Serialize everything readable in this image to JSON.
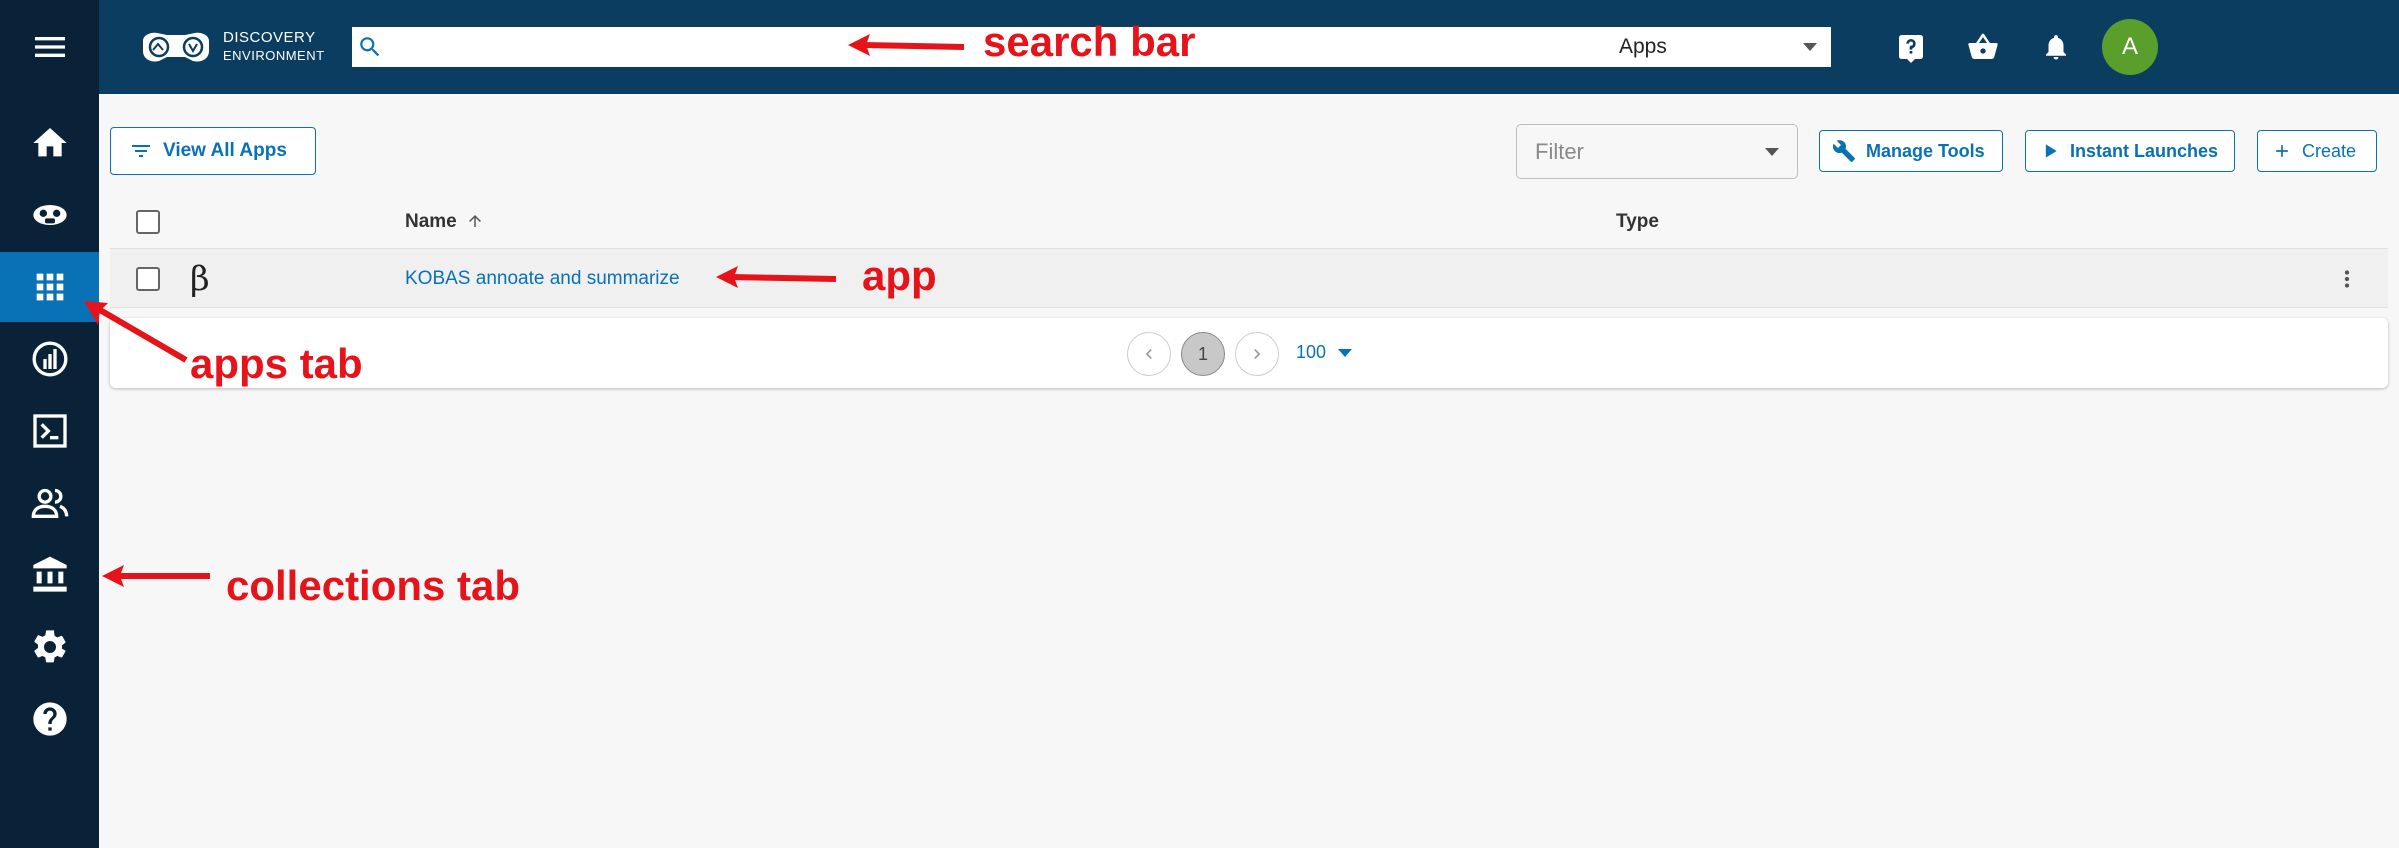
{
  "header": {
    "logo_line1": "DISCOVERY",
    "logo_line2": "ENVIRONMENT",
    "search_placeholder": "",
    "search_scope": "Apps",
    "avatar_initial": "A"
  },
  "sidebar": {
    "items": [
      {
        "name": "home",
        "icon": "home-icon"
      },
      {
        "name": "data",
        "icon": "data-icon"
      },
      {
        "name": "apps",
        "icon": "apps-grid-icon",
        "active": true
      },
      {
        "name": "analyses",
        "icon": "analyses-icon"
      },
      {
        "name": "vice",
        "icon": "terminal-icon"
      },
      {
        "name": "teams",
        "icon": "teams-icon"
      },
      {
        "name": "collections",
        "icon": "collections-icon"
      },
      {
        "name": "settings",
        "icon": "gear-icon"
      },
      {
        "name": "help",
        "icon": "help-icon"
      }
    ]
  },
  "toolbar": {
    "view_all_apps": "View All Apps",
    "filter_placeholder": "Filter",
    "manage_tools": "Manage Tools",
    "instant_launches": "Instant Launches",
    "create": "Create"
  },
  "table": {
    "columns": [
      "Name",
      "Type"
    ],
    "rows": [
      {
        "badge": "β",
        "name": "KOBAS annoate and summarize",
        "type": ""
      }
    ]
  },
  "pagination": {
    "current_page": "1",
    "page_size": "100"
  },
  "annotations": {
    "search_bar": "search bar",
    "app": "app",
    "apps_tab": "apps tab",
    "collections_tab": "collections tab"
  },
  "colors": {
    "sidebar_bg": "#0a2238",
    "topbar_bg": "#0b3d60",
    "accent": "#0971b5",
    "annotation": "#e5141b",
    "avatar": "#5a9e2b"
  }
}
